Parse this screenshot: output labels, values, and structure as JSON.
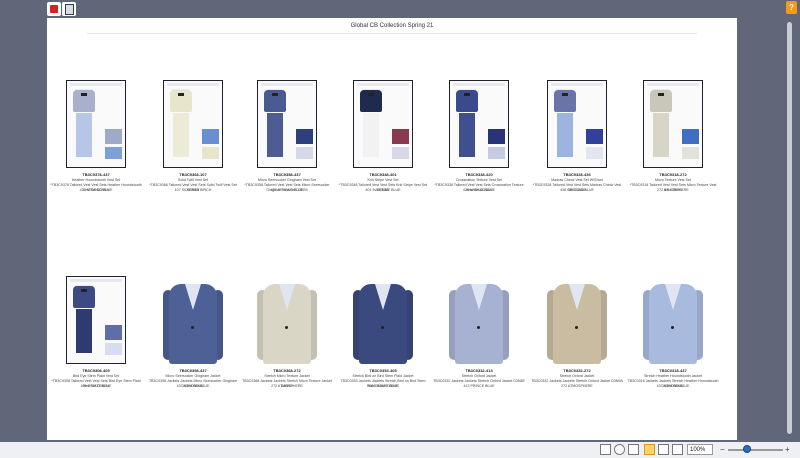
{
  "page": {
    "title": "Global CB Collection Spring 21"
  },
  "topbar": {
    "icons": [
      "brand-logo-icon",
      "document-icon"
    ],
    "badge": "?"
  },
  "products": [
    {
      "type": "set",
      "sku": "TB3C9378-437",
      "line1": "Heather Houndstooth Vest Set",
      "line2": "*TB3C9378 Tailored Vest Vest Sets Heather Houndstooth Vest Set D3N1H",
      "line3": "437 STRONG BLUE",
      "vest": "#a8b0cd",
      "pants": "#b5c6e6",
      "sw1": "#9fa9c8",
      "sw2": "#7ea0d8"
    },
    {
      "type": "set",
      "sku": "TB3C9368-107",
      "line1": "Solid Twill Vest Set",
      "line2": "*TB3C9368 Tailored Vest Vest Sets Solid Twill Vest Set D3N4B",
      "line3": "107 SILVERED BIRCH",
      "vest": "#e7e6cd",
      "pants": "#ebebd6",
      "sw1": "#6a8fd0",
      "sw2": "#e7e6cd"
    },
    {
      "type": "set",
      "sku": "TB3C9358-437",
      "line1": "Micro Seersucker Gingham Vest Set",
      "line2": "*TB3C9358 Tailored Vest Vest Sets Micro Seersucker Gingham Vest Set D3N39",
      "line3": "437 STRONG BLUE",
      "vest": "#4a5a93",
      "pants": "#4d5c93",
      "sw1": "#2f3e7d",
      "sw2": "#d6d9e8"
    },
    {
      "type": "set",
      "sku": "TB3C9348-401",
      "line1": "Knit Stripe Vest Set",
      "line2": "*TB3C9348 Tailored Vest Vest Sets Knit Stripe Vest Set D3N3B",
      "line3": "401 MARITIME BLUE",
      "vest": "#1f2a4f",
      "pants": "#f2f2f2",
      "sw1": "#8a3a4e",
      "sw2": "#d8d8e6"
    },
    {
      "type": "set",
      "sku": "TB3C9338-420",
      "line1": "Crossnation Texture Vest Set",
      "line2": "*TB3C9338 Tailored Vest Vest Sets Crossnation Texture Vest Set D3N3H",
      "line3": "420 NASSAU BLUE",
      "vest": "#3a4a8d",
      "pants": "#3f4f90",
      "sw1": "#2a3375",
      "sw2": "#c6cbe2"
    },
    {
      "type": "set",
      "sku": "TB3C9328-436",
      "line1": "Madras Check Vest Set W/Short",
      "line2": "*TB3C9328 Tailored Vest Vest Sets Madras Check Vest Set D3N3D",
      "line3": "436 GRECIAN BLUE",
      "vest": "#6b74a8",
      "pants": "#9db4e0",
      "sw1": "#33409a",
      "sw2": "#e3e6f1"
    },
    {
      "type": "set",
      "sku": "TB3C9318-272",
      "line1": "Micro Texture Vest Set",
      "line2": "*TB3C9318 Tailored Vest Vest Sets Micro Texture Vest Set D3N2C",
      "line3": "272 ATMOSPHERE",
      "vest": "#c9c7b9",
      "pants": "#d7d5c6",
      "sw1": "#3e6fc3",
      "sw2": "#e2e2da"
    },
    {
      "type": "set",
      "sku": "TB3C9308-405",
      "line1": "Bird Eye Stem Plaid Vest Set",
      "line2": "*TB3C9308 Tailored Vest Vest Sets Bird Eye Stem Plaid Vest Set D3N3H",
      "line3": "405 ESTATE BLUE",
      "vest": "#3d4a86",
      "pants": "#2f3a70",
      "sw1": "#5f6ea9",
      "sw2": "#d7dcef"
    },
    {
      "type": "jacket",
      "sku": "TB3C0398-437",
      "line1": "Micro Seersucker Gingham Jacket",
      "line2": "TB3C0398 Jackets Jackets Micro Seersucker Gingham Jacket D3N81",
      "line3": "437 STRONG BLUE",
      "color": "#4d6196"
    },
    {
      "type": "jacket",
      "sku": "TB3C0368-272",
      "line1": "Stretch Micro Texture Jacket",
      "line2": "TB3C0368 Jackets Jackets Stretch Micro Texture Jacket D3N9D",
      "line3": "272 ATMOSPHERE",
      "color": "#d9d6c6"
    },
    {
      "type": "jacket",
      "sku": "TB3C0353-405",
      "line1": "Stretch Bird on Bird Stem Plaid Jacket",
      "line2": "TB3C0353 Jackets Jackets Stretch Bird on Bird Stem Plaid Jacket D3N9C",
      "line3": "405 ESTATE BLUE",
      "color": "#3a4a7e"
    },
    {
      "type": "jacket",
      "sku": "TB3C0332-413",
      "line1": "Stretch Oxford Jacket",
      "line2": "TB3C0332 Jackets Jackets Stretch Oxford Jacket D3N8E",
      "line3": "413 PRINCE BLUE",
      "color": "#a7b2d3"
    },
    {
      "type": "jacket",
      "sku": "TB3C0332-272",
      "line1": "Stretch Oxford Jacket",
      "line2": "TB3C0332 Jackets Jackets Stretch Oxford Jacket D3N9A",
      "line3": "272 ATMOSPHERE",
      "color": "#c9bca1"
    },
    {
      "type": "jacket",
      "sku": "TB3C0318-437",
      "line1": "Stretch Heather Houndstooth Jacket",
      "line2": "TB3C0318 Jackets Jackets Stretch Heather Houndstooth Jacket D3N81",
      "line3": "437 STRONG BLUE",
      "color": "#a8bbdf"
    }
  ],
  "bottombar": {
    "tools": [
      "presentation-icon",
      "clock-icon",
      "columns-icon",
      "grid-view-icon",
      "list-view-icon",
      "fit-page-icon"
    ],
    "zoom": "100%",
    "zoom_minus": "−",
    "zoom_plus": "+"
  },
  "colors": {
    "background": "#5f6779",
    "accent": "#f29a1a"
  }
}
